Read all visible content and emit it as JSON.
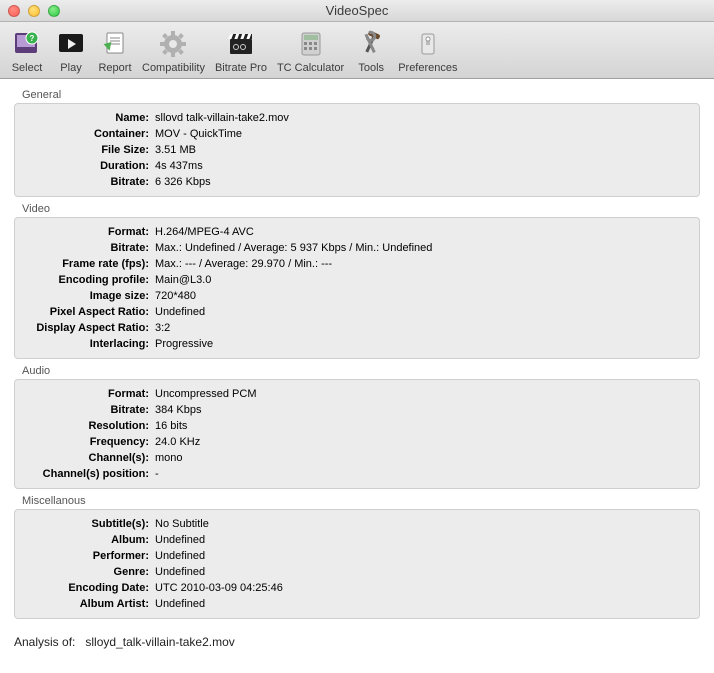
{
  "window": {
    "title": "VideoSpec"
  },
  "toolbar": {
    "items": [
      {
        "label": "Select"
      },
      {
        "label": "Play"
      },
      {
        "label": "Report"
      },
      {
        "label": "Compatibility"
      },
      {
        "label": "Bitrate Pro"
      },
      {
        "label": "TC Calculator"
      },
      {
        "label": "Tools"
      },
      {
        "label": "Preferences"
      }
    ]
  },
  "sections": {
    "general": {
      "title": "General",
      "rows": {
        "name": {
          "label": "Name:",
          "value": "sllovd  talk-villain-take2.mov"
        },
        "container": {
          "label": "Container:",
          "value": "MOV - QuickTime"
        },
        "filesize": {
          "label": "File Size:",
          "value": "3.51 MB"
        },
        "duration": {
          "label": "Duration:",
          "value": "4s 437ms"
        },
        "bitrate": {
          "label": "Bitrate:",
          "value": "6 326 Kbps"
        }
      }
    },
    "video": {
      "title": "Video",
      "rows": {
        "format": {
          "label": "Format:",
          "value": "H.264/MPEG-4 AVC"
        },
        "bitrate": {
          "label": "Bitrate:",
          "value": "Max.: Undefined / Average: 5 937 Kbps / Min.: Undefined"
        },
        "framerate": {
          "label": "Frame rate (fps):",
          "value": "Max.: --- / Average: 29.970 / Min.: ---"
        },
        "profile": {
          "label": "Encoding profile:",
          "value": "Main@L3.0"
        },
        "imagesize": {
          "label": "Image size:",
          "value": "720*480"
        },
        "par": {
          "label": "Pixel Aspect Ratio:",
          "value": "Undefined"
        },
        "dar": {
          "label": "Display Aspect Ratio:",
          "value": "3:2"
        },
        "interlace": {
          "label": "Interlacing:",
          "value": "Progressive"
        }
      }
    },
    "audio": {
      "title": "Audio",
      "rows": {
        "format": {
          "label": "Format:",
          "value": "Uncompressed PCM"
        },
        "bitrate": {
          "label": "Bitrate:",
          "value": "384 Kbps"
        },
        "resolution": {
          "label": "Resolution:",
          "value": "16 bits"
        },
        "frequency": {
          "label": "Frequency:",
          "value": "24.0 KHz"
        },
        "channels": {
          "label": "Channel(s):",
          "value": "mono"
        },
        "chpos": {
          "label": "Channel(s) position:",
          "value": "-"
        }
      }
    },
    "misc": {
      "title": "Miscellanous",
      "rows": {
        "subtitles": {
          "label": "Subtitle(s):",
          "value": "No Subtitle"
        },
        "album": {
          "label": "Album:",
          "value": "Undefined"
        },
        "performer": {
          "label": "Performer:",
          "value": "Undefined"
        },
        "genre": {
          "label": "Genre:",
          "value": "Undefined"
        },
        "encdate": {
          "label": "Encoding Date:",
          "value": "UTC 2010-03-09 04:25:46"
        },
        "albumartist": {
          "label": "Album Artist:",
          "value": "Undefined"
        }
      }
    }
  },
  "footer": {
    "label": "Analysis of:",
    "filename": "slloyd_talk-villain-take2.mov"
  }
}
